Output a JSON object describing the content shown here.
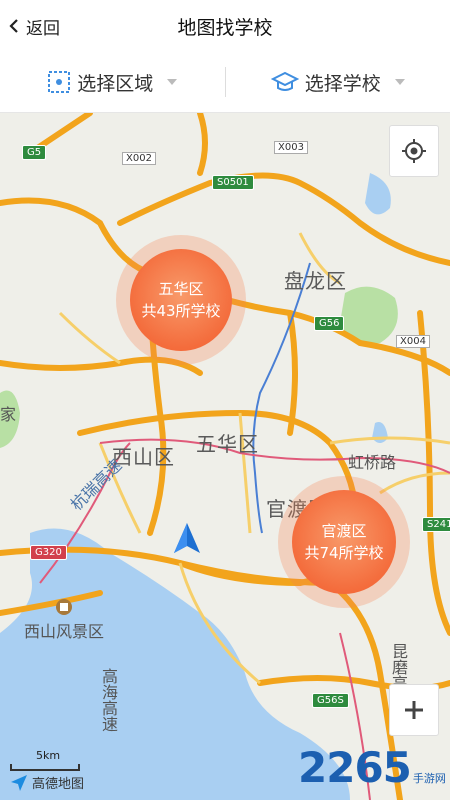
{
  "header": {
    "back_label": "返回",
    "title": "地图找学校"
  },
  "filters": {
    "region_label": "选择区域",
    "school_label": "选择学校"
  },
  "map": {
    "clusters": [
      {
        "name": "五华区",
        "count_text": "共43所学校"
      },
      {
        "name": "官渡区",
        "count_text": "共74所学校"
      }
    ],
    "district_labels": {
      "panlong": "盘龙区",
      "xishan": "西山区",
      "wuhua": "五华区",
      "guandu": "官渡区"
    },
    "place_labels": {
      "xishan_scenic": "西山风景区",
      "hongqiao": "虹桥路",
      "hangrui": "杭瑞高速",
      "gaohai": "高海高速",
      "kunmo": "昆磨高速",
      "jia": "家"
    },
    "road_shields": {
      "g5": "G5",
      "s0501": "S0501",
      "g56": "G56",
      "g320": "G320",
      "g56s": "G56S",
      "s241": "S241"
    },
    "road_codes": {
      "x002": "X002",
      "x003": "X003",
      "x004": "X004"
    },
    "scale_label": "5km",
    "brand": "高德地图",
    "watermark": "2265",
    "watermark_small": "手游网"
  }
}
